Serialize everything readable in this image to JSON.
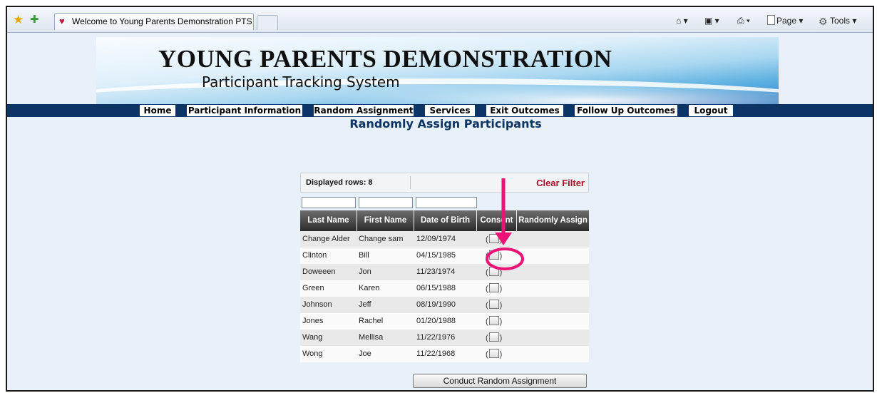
{
  "browser": {
    "tab_title": "Welcome to Young Parents Demonstration PTS",
    "commands": {
      "page": "Page ▾",
      "tools": "Tools ▾"
    }
  },
  "banner": {
    "title": "YOUNG PARENTS DEMONSTRATION",
    "subtitle": "Participant Tracking System"
  },
  "nav": [
    {
      "label": "Home"
    },
    {
      "label": "Participant Information"
    },
    {
      "label": "Random Assignment"
    },
    {
      "label": "Services"
    },
    {
      "label": "Exit Outcomes"
    },
    {
      "label": "Follow Up Outcomes"
    },
    {
      "label": "Logout"
    }
  ],
  "page_title": "Randomly Assign Participants",
  "grid": {
    "displayed_rows": "Displayed rows: 8",
    "clear_filter": "Clear Filter",
    "columns": [
      "Last Name",
      "First Name",
      "Date of Birth",
      "Consent",
      "Randomly Assign"
    ],
    "rows": [
      {
        "last": "Change Alder",
        "first": "Change sam",
        "dob": "12/09/1974",
        "consent": "(",
        "consent_end": ")"
      },
      {
        "last": "Clinton",
        "first": "Bill",
        "dob": "04/15/1985",
        "consent": "(",
        "consent_end": ")"
      },
      {
        "last": "Doweeen",
        "first": "Jon",
        "dob": "11/23/1974",
        "consent": "(",
        "consent_end": ")"
      },
      {
        "last": "Green",
        "first": "Karen",
        "dob": "06/15/1988",
        "consent": "(",
        "consent_end": ")"
      },
      {
        "last": "Johnson",
        "first": "Jeff",
        "dob": "08/19/1990",
        "consent": "(",
        "consent_end": ")"
      },
      {
        "last": "Jones",
        "first": "Rachel",
        "dob": "01/20/1988",
        "consent": "(",
        "consent_end": ")"
      },
      {
        "last": "Wang",
        "first": "Mellisa",
        "dob": "11/22/1976",
        "consent": "(",
        "consent_end": ")"
      },
      {
        "last": "Wong",
        "first": "Joe",
        "dob": "11/22/1968",
        "consent": "(",
        "consent_end": ")"
      }
    ],
    "submit_label": "Conduct Random Assignment"
  },
  "colors": {
    "nav_bar": "#0c3565",
    "page_bg": "#e8f0fa",
    "clear_filter": "#b0102a",
    "annotation": "#ee1277"
  }
}
